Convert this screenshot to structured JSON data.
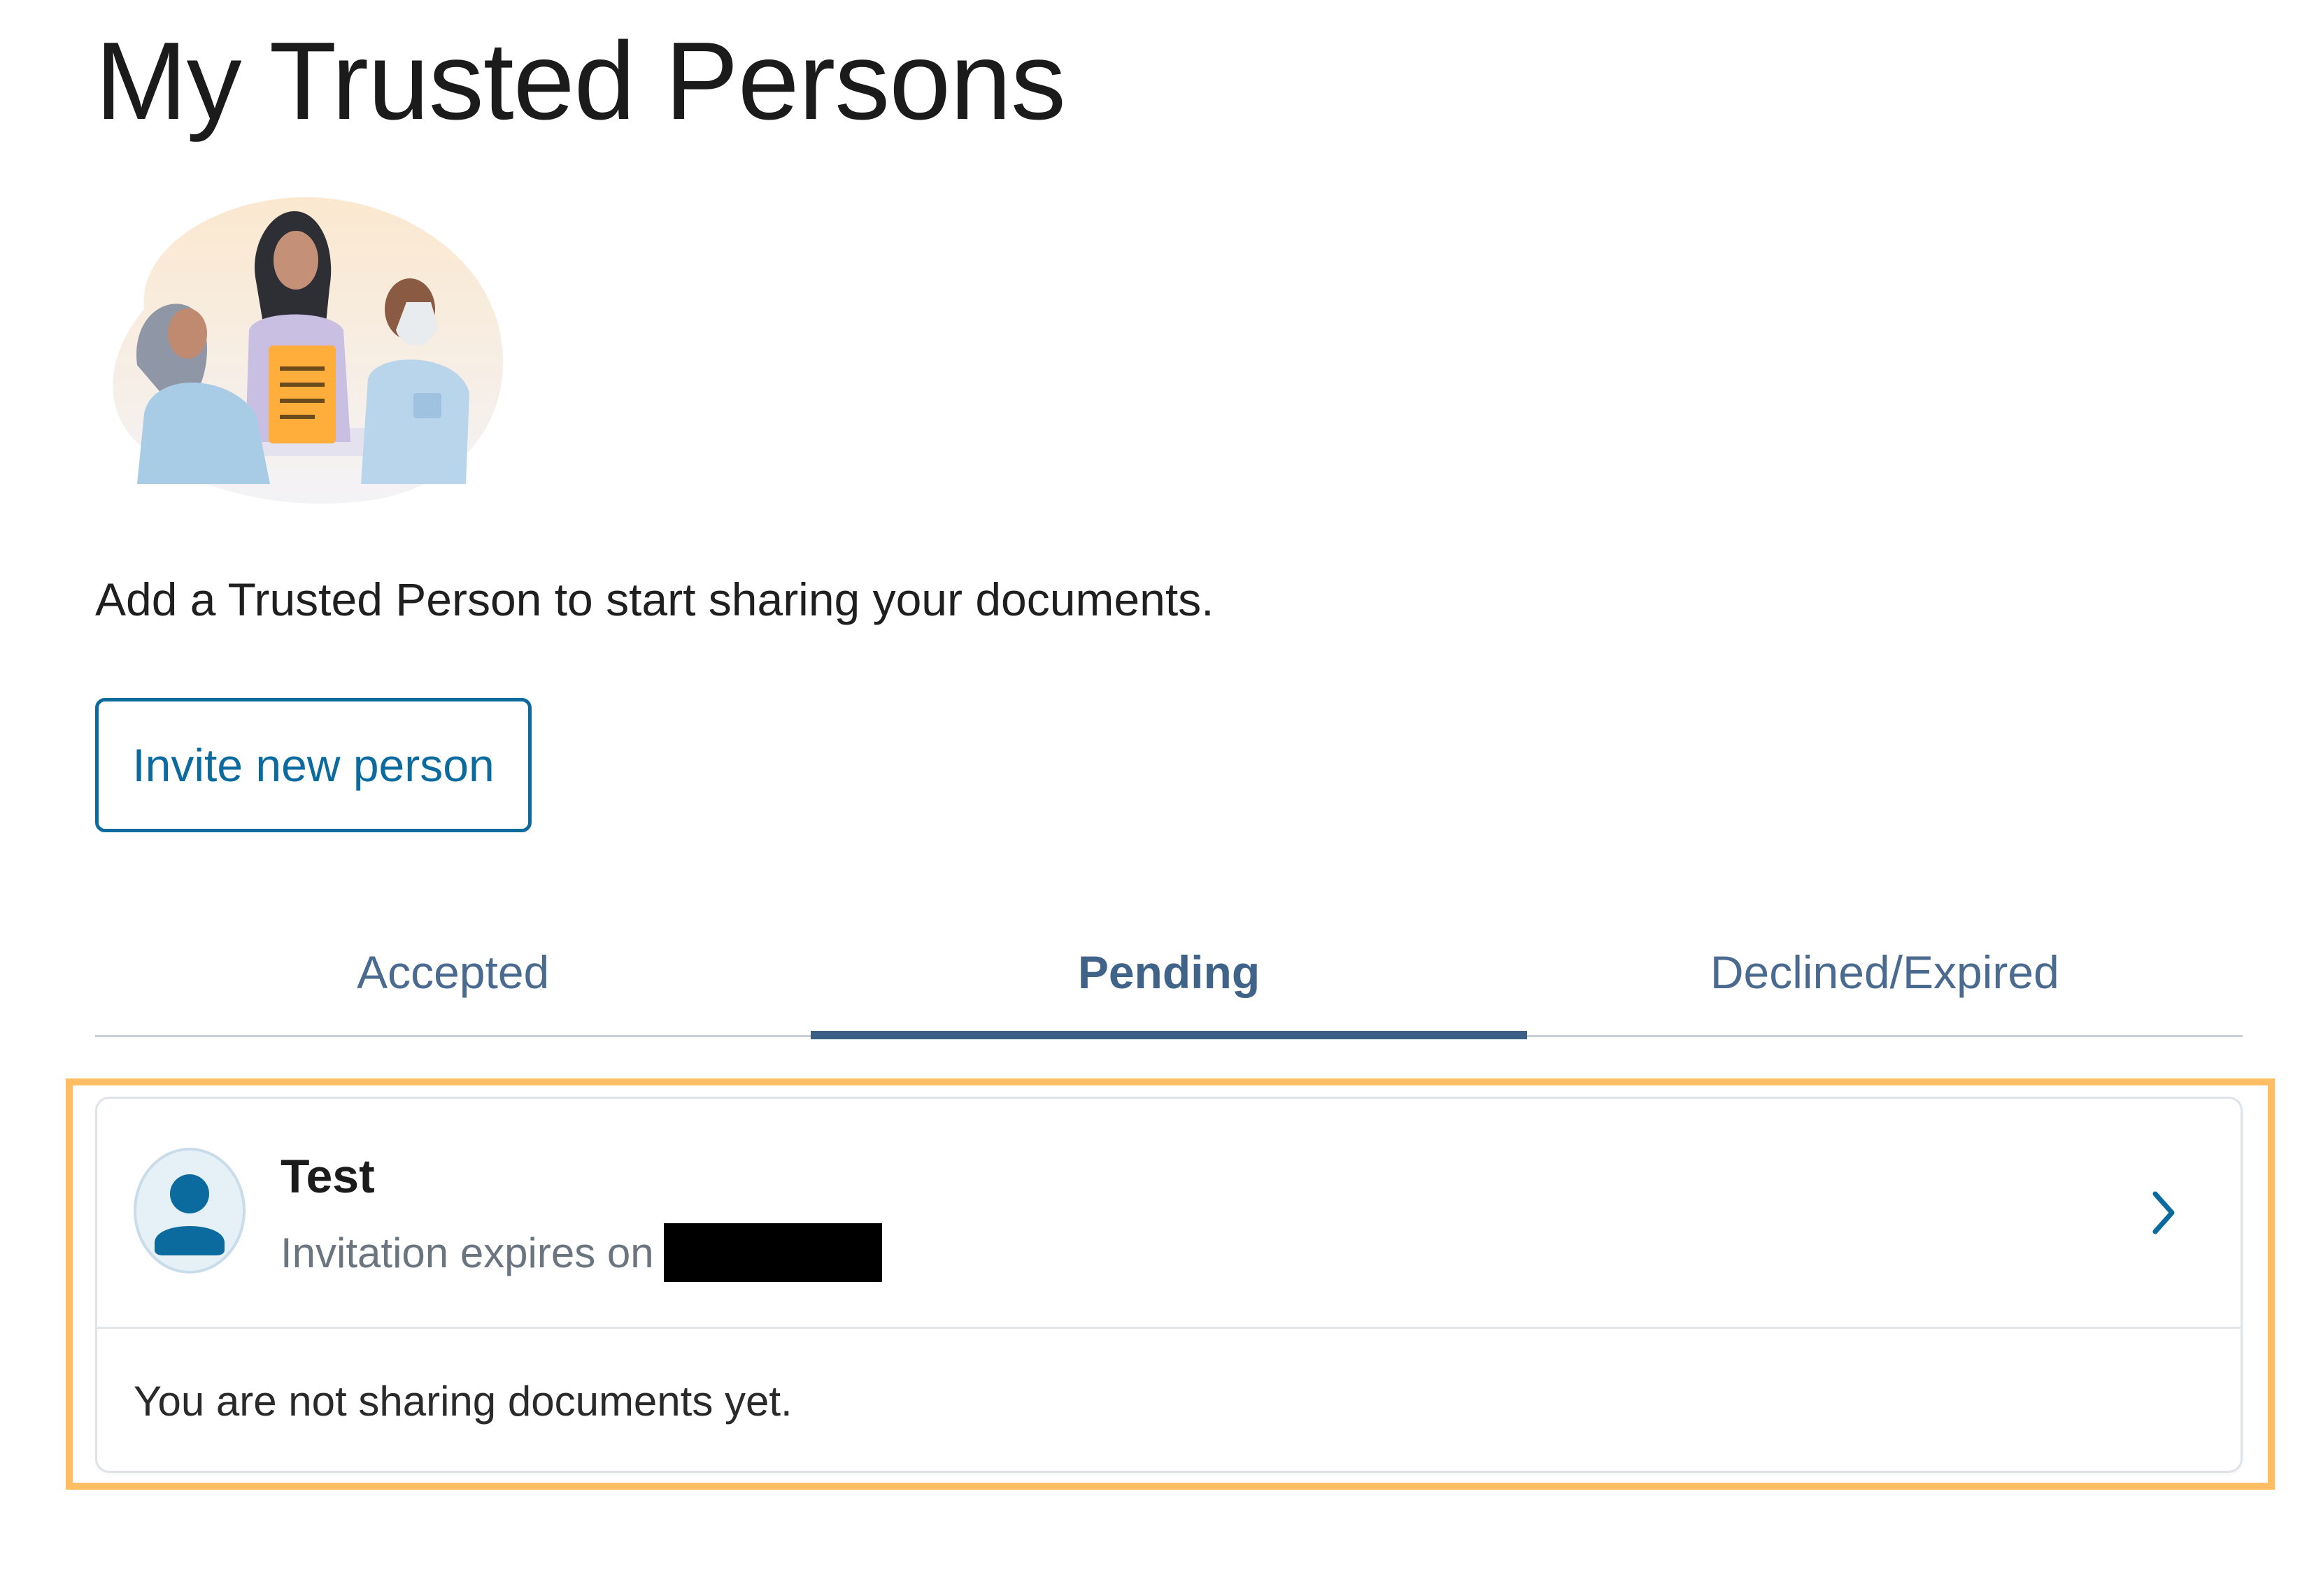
{
  "page": {
    "title": "My Trusted Persons",
    "intro": "Add a Trusted Person to start sharing your documents."
  },
  "actions": {
    "invite_label": "Invite new person"
  },
  "tabs": [
    {
      "label": "Accepted",
      "active": false
    },
    {
      "label": "Pending",
      "active": true
    },
    {
      "label": "Declined/Expired",
      "active": false
    }
  ],
  "pending_card": {
    "name": "Test",
    "expiry_label": "Invitation expires on",
    "expiry_date_redacted": true,
    "sharing_status": "You are not sharing documents yet."
  },
  "icons": {
    "avatar": "person-icon",
    "chevron": "chevron-right-icon"
  },
  "colors": {
    "accent": "#0b6a9e",
    "tab_text": "#4a6a8f",
    "tab_indicator": "#3b5f85",
    "highlight": "#ffbe63"
  }
}
